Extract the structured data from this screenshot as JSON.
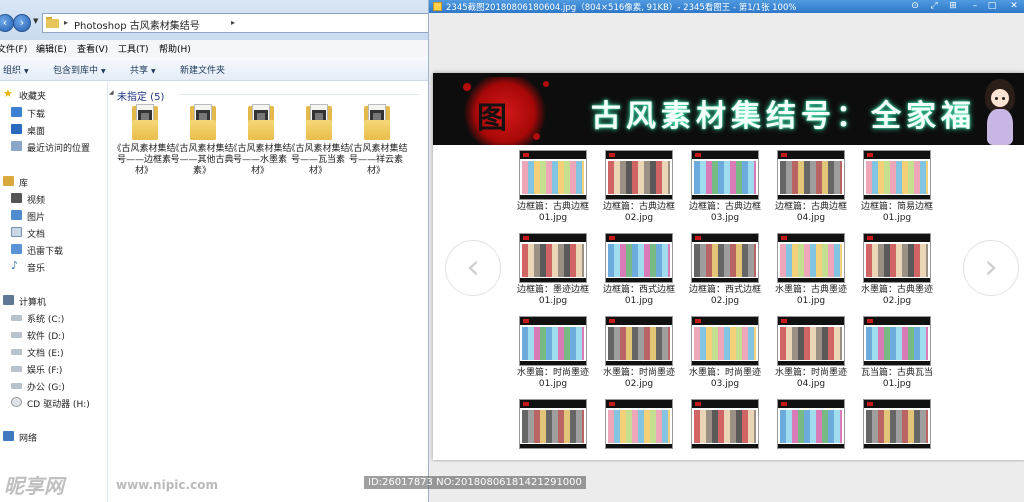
{
  "explorer": {
    "breadcrumb": [
      "Photoshop 古风素材集结号"
    ],
    "menu": [
      "文件(F)",
      "编辑(E)",
      "查看(V)",
      "工具(T)",
      "帮助(H)"
    ],
    "toolbar": [
      "组织",
      "包含到库中",
      "共享",
      "新建文件夹"
    ],
    "nav": {
      "favorites_title": "收藏夹",
      "favorites": [
        "下载",
        "桌面",
        "最近访问的位置"
      ],
      "libraries_title": "库",
      "libraries": [
        "视频",
        "图片",
        "文档",
        "迅雷下载",
        "音乐"
      ],
      "computer_title": "计算机",
      "drives": [
        "系统 (C:)",
        "软件 (D:)",
        "文档 (E:)",
        "娱乐 (F:)",
        "办公 (G:)",
        "CD 驱动器 (H:)"
      ],
      "network": "网络"
    },
    "group_header": "未指定 (5)",
    "files": [
      "《古风素材集结号——边框素材》",
      "《古风素材集结号——其他古典素》",
      "《古风素材集结号——水墨素材》",
      "《古风素材集结号——瓦当素材》",
      "《古风素材集结号——祥云素材》"
    ]
  },
  "viewer": {
    "title": "2345截图20180806180604.jpg（804×516像素, 91KB）- 2345看图王 - 第1/1张 100%",
    "accent_color": "#2e78c8",
    "banner_title": "古风素材集结号：全家福",
    "stamp_glyph": "图",
    "thumbnails": [
      [
        "边框篇：古典边框01.jpg",
        "边框篇：古典边框02.jpg",
        "边框篇：古典边框03.jpg",
        "边框篇：古典边框04.jpg",
        "边框篇：简易边框01.jpg"
      ],
      [
        "边框篇：墨迹边框01.jpg",
        "边框篇：西式边框01.jpg",
        "边框篇：西式边框02.jpg",
        "水墨篇：古典墨迹01.jpg",
        "水墨篇：古典墨迹02.jpg"
      ],
      [
        "水墨篇：时尚墨迹01.jpg",
        "水墨篇：时尚墨迹02.jpg",
        "水墨篇：时尚墨迹03.jpg",
        "水墨篇：时尚墨迹04.jpg",
        "瓦当篇：古典瓦当01.jpg"
      ],
      [
        "",
        "",
        "",
        "",
        ""
      ]
    ],
    "prev_icon": "arrow-left-icon",
    "next_icon": "arrow-right-icon"
  },
  "watermark": {
    "logo": "昵享网",
    "url": "www.nipic.com",
    "id": "ID:26017873 NO:20180806181421291000"
  }
}
